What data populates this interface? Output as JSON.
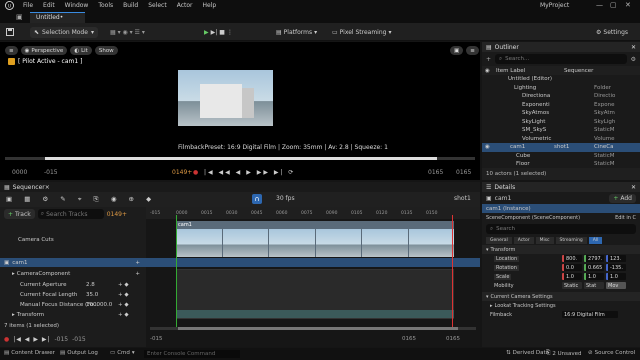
{
  "menu": {
    "items": [
      "File",
      "Edit",
      "Window",
      "Tools",
      "Build",
      "Select",
      "Actor",
      "Help"
    ],
    "project": "MyProject"
  },
  "tab": {
    "title": "Untitled•"
  },
  "toolbar": {
    "mode": "Selection Mode",
    "platforms": "Platforms",
    "streaming": "Pixel Streaming",
    "settings": "Settings"
  },
  "viewport": {
    "perspective": "Perspective",
    "lit": "Lit",
    "show": "Show",
    "pilot": "[ Pilot Active - cam1 ]",
    "caminfo": "FilmbackPreset: 16:9 Digital Film | Zoom: 35mm | Av: 2.8 | Squeeze: 1",
    "ctrl_left": "0000",
    "ctrl_start": "-015",
    "ctrl_cur": "0149+",
    "ctrl_end": "0165",
    "ctrl_far": "0165"
  },
  "outliner": {
    "title": "Outliner",
    "search": "Search...",
    "col_label": "Item Label",
    "col_seq": "Sequencer",
    "rows": [
      {
        "name": "Untitled (Editor)",
        "type": "",
        "seq": ""
      },
      {
        "name": "Lighting",
        "type": "Folder",
        "seq": ""
      },
      {
        "name": "Directiona",
        "type": "Directio",
        "seq": ""
      },
      {
        "name": "Exponenti",
        "type": "Expone",
        "seq": ""
      },
      {
        "name": "SkyAtmos",
        "type": "SkyAtm",
        "seq": ""
      },
      {
        "name": "SkyLight",
        "type": "SkyLigh",
        "seq": ""
      },
      {
        "name": "SM_SkyS",
        "type": "StaticM",
        "seq": ""
      },
      {
        "name": "Volumetric",
        "type": "Volume",
        "seq": ""
      },
      {
        "name": "cam1",
        "type": "CineCa",
        "seq": "shot1"
      },
      {
        "name": "Cube",
        "type": "StaticM",
        "seq": ""
      },
      {
        "name": "Floor",
        "type": "StaticM",
        "seq": ""
      }
    ],
    "footer": "10 actors (1 selected)"
  },
  "sequencer": {
    "tab": "Sequencer×",
    "fps": "30 fps",
    "shot": "shot1",
    "add_track": "Track",
    "search": "Search Tracks",
    "frame": "0149+",
    "ruler": [
      "-015",
      "0000",
      "0015",
      "0030",
      "0045",
      "0060",
      "0075",
      "0090",
      "0105",
      "0120",
      "0135",
      "0150"
    ],
    "tracks": [
      {
        "label": "Camera Cuts",
        "value": ""
      },
      {
        "label": "cam1",
        "value": ""
      },
      {
        "label": "CameraComponent",
        "value": ""
      },
      {
        "label": "Current Aperture",
        "value": "2.8"
      },
      {
        "label": "Current Focal Length",
        "value": "35.0"
      },
      {
        "label": "Manual Focus Distance (Fo...",
        "value": "100000.0"
      },
      {
        "label": "Transform",
        "value": ""
      }
    ],
    "footer": "7 items (1 selected)",
    "bottom_start": "-015",
    "bottom_start2": "-015",
    "bottom_end": "0165",
    "bottom_end2": "0165",
    "clip": "cam1"
  },
  "details": {
    "title": "Details",
    "actor": "cam1",
    "add": "Add",
    "instance": "cam1 (Instance)",
    "component": "SceneComponent (SceneComponent)",
    "edit": "Edit in C",
    "search": "Search",
    "filters": [
      "General",
      "Actor",
      "Misc",
      "Streaming",
      "All"
    ],
    "section": "Transform",
    "props": [
      {
        "label": "Location",
        "x": "800.",
        "y": "2797.",
        "z": "123."
      },
      {
        "label": "Rotation",
        "x": "0.0",
        "y": "0.665",
        "z": "-135."
      },
      {
        "label": "Scale",
        "x": "1.0",
        "y": "1.0",
        "z": "1.0"
      }
    ],
    "mobility": "Mobility",
    "mob_opts": [
      "Static",
      "Stat",
      "Mov"
    ],
    "sec2": "Current Camera Settings",
    "sec3": "Lookat Tracking Settings",
    "filmback": "Filmback",
    "filmback_val": "16:9 Digital Film"
  },
  "status": {
    "drawer": "Content Drawer",
    "log": "Output Log",
    "cmd": "Cmd",
    "console": "Enter Console Command",
    "derived": "Derived Data",
    "unsaved": "2 Unsaved",
    "source": "Source Control"
  }
}
